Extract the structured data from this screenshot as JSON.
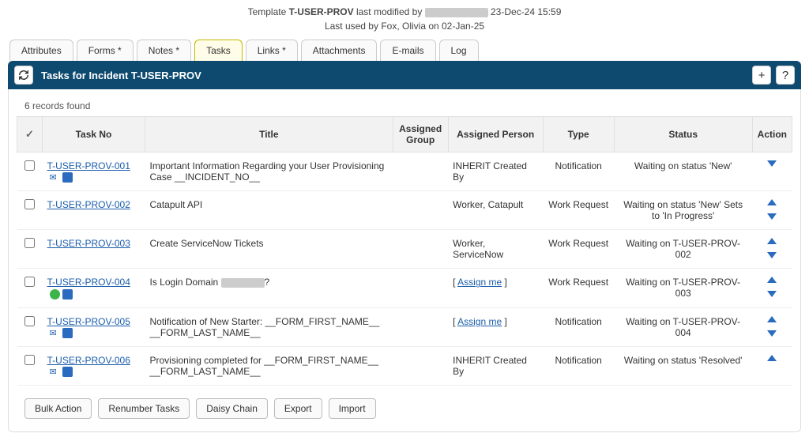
{
  "meta": {
    "line1a": "Template ",
    "template_id": "T-USER-PROV",
    "line1b": " last modified by ",
    "line1c": " 23-Dec-24 15:59",
    "line2": "Last used by Fox, Olivia on 02-Jan-25"
  },
  "tabs": [
    {
      "label": "Attributes",
      "active": false
    },
    {
      "label": "Forms *",
      "active": false
    },
    {
      "label": "Notes *",
      "active": false
    },
    {
      "label": "Tasks",
      "active": true
    },
    {
      "label": "Links *",
      "active": false
    },
    {
      "label": "Attachments",
      "active": false
    },
    {
      "label": "E-mails",
      "active": false
    },
    {
      "label": "Log",
      "active": false
    }
  ],
  "panel": {
    "title": "Tasks for Incident T-USER-PROV"
  },
  "records_found": "6 records found",
  "columns": {
    "task_no": "Task No",
    "title": "Title",
    "group": "Assigned Group",
    "person": "Assigned Person",
    "type": "Type",
    "status": "Status",
    "action": "Action"
  },
  "rows": [
    {
      "task_no": "T-USER-PROV-001",
      "icons": [
        "mail",
        "blue"
      ],
      "title": "Important Information Regarding your User Provisioning Case __INCIDENT_NO__",
      "group": "",
      "person": "INHERIT Created By",
      "type": "Notification",
      "status": "Waiting on status 'New'",
      "up": false,
      "down": true
    },
    {
      "task_no": "T-USER-PROV-002",
      "icons": [],
      "title": "Catapult API",
      "group": "",
      "person": "Worker, Catapult",
      "type": "Work Request",
      "status": "Waiting on status 'New' Sets to 'In Progress'",
      "up": true,
      "down": true
    },
    {
      "task_no": "T-USER-PROV-003",
      "icons": [],
      "title": "Create ServiceNow Tickets",
      "group": "",
      "person": "Worker, ServiceNow",
      "type": "Work Request",
      "status": "Waiting on T-USER-PROV-002",
      "up": true,
      "down": true
    },
    {
      "task_no": "T-USER-PROV-004",
      "icons": [
        "green",
        "blue"
      ],
      "title_pre": "Is Login Domain ",
      "title_post": "?",
      "redacted_title": true,
      "group": "",
      "person_link": "Assign me",
      "type": "Work Request",
      "status": "Waiting on T-USER-PROV-003",
      "up": true,
      "down": true
    },
    {
      "task_no": "T-USER-PROV-005",
      "icons": [
        "mail",
        "blue"
      ],
      "title": "Notification of New Starter: __FORM_FIRST_NAME__ __FORM_LAST_NAME__",
      "group": "",
      "person_link": "Assign me",
      "type": "Notification",
      "status": "Waiting on T-USER-PROV-004",
      "up": true,
      "down": true
    },
    {
      "task_no": "T-USER-PROV-006",
      "icons": [
        "mail",
        "blue"
      ],
      "title": "Provisioning completed for __FORM_FIRST_NAME__ __FORM_LAST_NAME__",
      "group": "",
      "person": "INHERIT Created By",
      "type": "Notification",
      "status": "Waiting on status 'Resolved'",
      "up": true,
      "down": false
    }
  ],
  "buttons": {
    "bulk": "Bulk Action",
    "renumber": "Renumber Tasks",
    "daisy": "Daisy Chain",
    "export": "Export",
    "import": "Import"
  }
}
